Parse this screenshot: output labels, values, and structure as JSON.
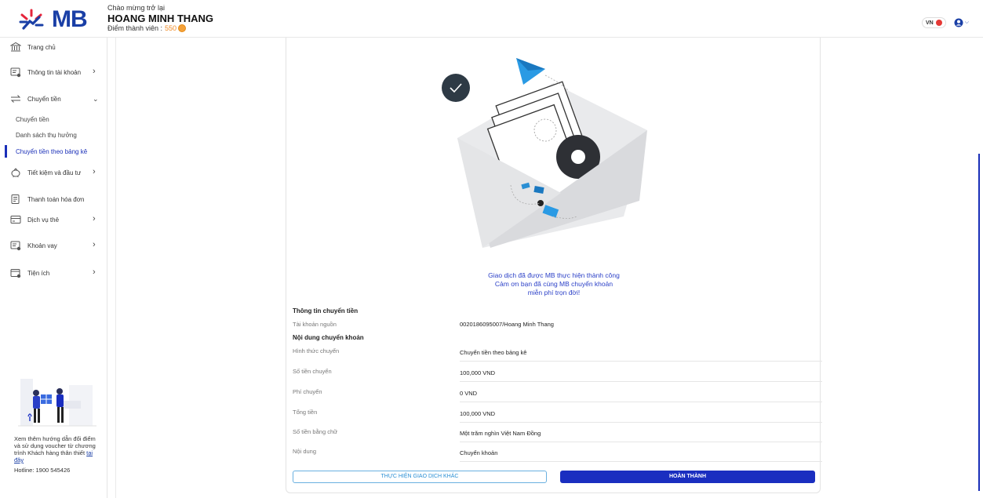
{
  "header": {
    "brand": "MB",
    "welcome": "Chào mừng trở lại",
    "user_name": "HOANG MINH THANG",
    "points_label": "Điểm thành viên :",
    "points_value": "550",
    "language": "VN"
  },
  "sidebar": {
    "items": [
      {
        "label": "Trang chủ",
        "icon": "bank-icon"
      },
      {
        "label": "Thông tin tài khoản",
        "icon": "account-card-icon"
      },
      {
        "label": "Chuyển tiền",
        "icon": "transfer-icon"
      },
      {
        "label": "Tiết kiệm và đầu tư",
        "icon": "piggy-bank-icon"
      },
      {
        "label": "Thanh toán hóa đơn",
        "icon": "bill-icon"
      },
      {
        "label": "Dịch vụ thẻ",
        "icon": "card-icon"
      },
      {
        "label": "Khoản vay",
        "icon": "loan-icon"
      },
      {
        "label": "Tiện ích",
        "icon": "utility-icon"
      }
    ],
    "transfer_sub": [
      {
        "label": "Chuyển tiền"
      },
      {
        "label": "Danh sách thụ hưởng"
      },
      {
        "label": "Chuyển tiền theo bảng kê"
      }
    ],
    "promo_text": "Xem thêm hướng dẫn đổi điểm và sử dụng voucher từ chương trình Khách hàng thân thiết",
    "promo_link": "tại đây",
    "hotline": "Hotline: 1900 545426"
  },
  "result": {
    "success_line1": "Giao dịch đã được MB thực hiện thành công",
    "success_line2": "Cảm ơn bạn đã cùng MB chuyển khoản",
    "success_line3": "miễn phí trọn đời!",
    "section_transfer_info": "Thông tin chuyển tiền",
    "source_account_label": "Tài khoản nguồn",
    "source_account_value": "0020186095007/Hoang Minh Thang",
    "section_content": "Nội dung chuyển khoản",
    "rows": [
      {
        "label": "Hình thức chuyển",
        "value": "Chuyển tiền theo bảng kê"
      },
      {
        "label": "Số tiền chuyển",
        "value": "100,000 VND"
      },
      {
        "label": "Phí chuyển",
        "value": "0 VND"
      },
      {
        "label": "Tổng tiền",
        "value": "100,000 VND"
      },
      {
        "label": "Số tiền bằng chữ",
        "value": "Một trăm nghìn Việt Nam Đồng"
      },
      {
        "label": "Nội dung",
        "value": "Chuyển khoản"
      }
    ],
    "btn_other": "THỰC HIỆN GIAO DỊCH KHÁC",
    "btn_done": "HOÀN THÀNH"
  },
  "colors": {
    "brand_blue": "#1a3fa6",
    "primary_button": "#1a2ec0",
    "success_text": "#2a3fc7",
    "points_orange": "#f08a24"
  }
}
